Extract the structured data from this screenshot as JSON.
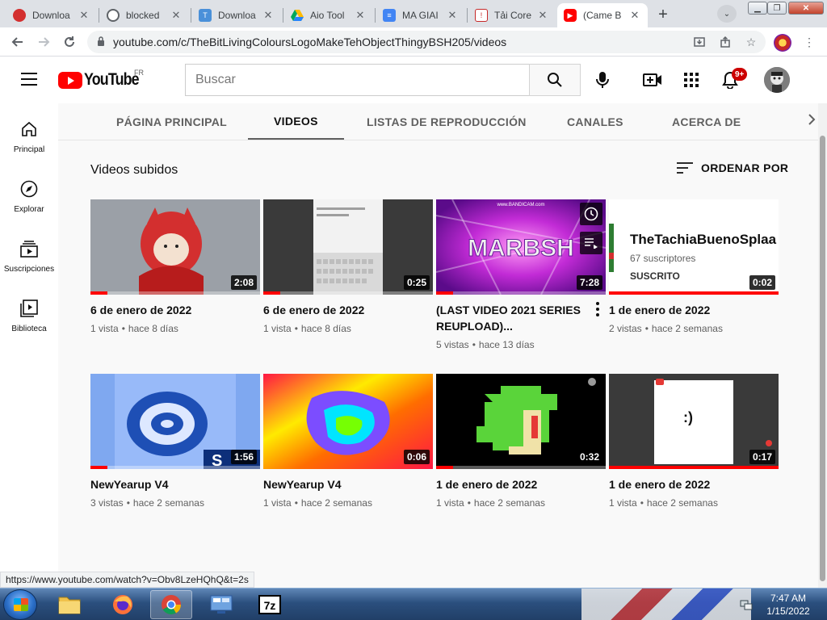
{
  "browser": {
    "tabs": [
      {
        "label": "Downloa",
        "favicon": "red-circle-icon",
        "color": "#d32f2f"
      },
      {
        "label": "blocked",
        "favicon": "globe-icon",
        "color": "#5f6368"
      },
      {
        "label": "Downloa",
        "favicon": "download-site-icon",
        "color": "#4a90d9"
      },
      {
        "label": "Aio Tool",
        "favicon": "google-drive-icon",
        "color": "#1e88e5"
      },
      {
        "label": "MA GIAI",
        "favicon": "google-docs-icon",
        "color": "#4285f4"
      },
      {
        "label": "Tải Core",
        "favicon": "file-icon",
        "color": "#c62828"
      },
      {
        "label": "(Came B",
        "favicon": "youtube-icon",
        "color": "#ff0000",
        "active": true
      }
    ],
    "url": "youtube.com/c/TheBitLivingColoursLogoMakeTehObjectThingyBSH205/videos"
  },
  "youtube": {
    "logo_text": "YouTube",
    "region": "FR",
    "search_placeholder": "Buscar",
    "notification_count": "9+"
  },
  "sidebar": {
    "items": [
      {
        "label": "Principal",
        "icon": "home-icon"
      },
      {
        "label": "Explorar",
        "icon": "compass-icon"
      },
      {
        "label": "Suscripciones",
        "icon": "subscriptions-icon"
      },
      {
        "label": "Biblioteca",
        "icon": "library-icon"
      }
    ]
  },
  "channel_tabs": [
    {
      "label": "PÁGINA PRINCIPAL"
    },
    {
      "label": "VIDEOS",
      "active": true
    },
    {
      "label": "LISTAS DE REPRODUCCIÓN"
    },
    {
      "label": "CANALES"
    },
    {
      "label": "ACERCA DE"
    }
  ],
  "section": {
    "title": "Videos subidos",
    "sort_label": "ORDENAR POR"
  },
  "videos": [
    {
      "title": "6 de enero de 2022",
      "views": "1 vista",
      "age": "hace 8 días",
      "duration": "2:08",
      "watched": 0.1
    },
    {
      "title": "6 de enero de 2022",
      "views": "1 vista",
      "age": "hace 8 días",
      "duration": "0:25",
      "watched": 0.1
    },
    {
      "title": "(LAST VIDEO 2021 SERIES REUPLOAD)...",
      "views": "5 vistas",
      "age": "hace 13 días",
      "duration": "7:28",
      "watched": 0.1,
      "overlay_text": "MARBSH",
      "watermark": "www.BANDICAM.com"
    },
    {
      "title": "1 de enero de 2022",
      "views": "2 vistas",
      "age": "hace 2 semanas",
      "duration": "0:02",
      "watched": 1.0,
      "thumb_channel": "TheTachiaBuenoSplaa",
      "thumb_subs": "67 suscriptores",
      "thumb_button": "SUSCRITO"
    },
    {
      "title": "NewYearup V4",
      "views": "3 vistas",
      "age": "hace 2 semanas",
      "duration": "1:56",
      "watched": 0.1
    },
    {
      "title": "NewYearup V4",
      "views": "1 vista",
      "age": "hace 2 semanas",
      "duration": "0:06",
      "watched": 0.0
    },
    {
      "title": "1 de enero de 2022",
      "views": "1 vista",
      "age": "hace 2 semanas",
      "duration": "0:32",
      "watched": 0.1
    },
    {
      "title": "1 de enero de 2022",
      "views": "1 vista",
      "age": "hace 2 semanas",
      "duration": "0:17",
      "watched": 1.0,
      "thumb_text": ":)"
    }
  ],
  "status_url": "https://www.youtube.com/watch?v=Obv8LzeHQhQ&t=2s",
  "taskbar": {
    "time": "7:47 AM",
    "date": "1/15/2022"
  }
}
